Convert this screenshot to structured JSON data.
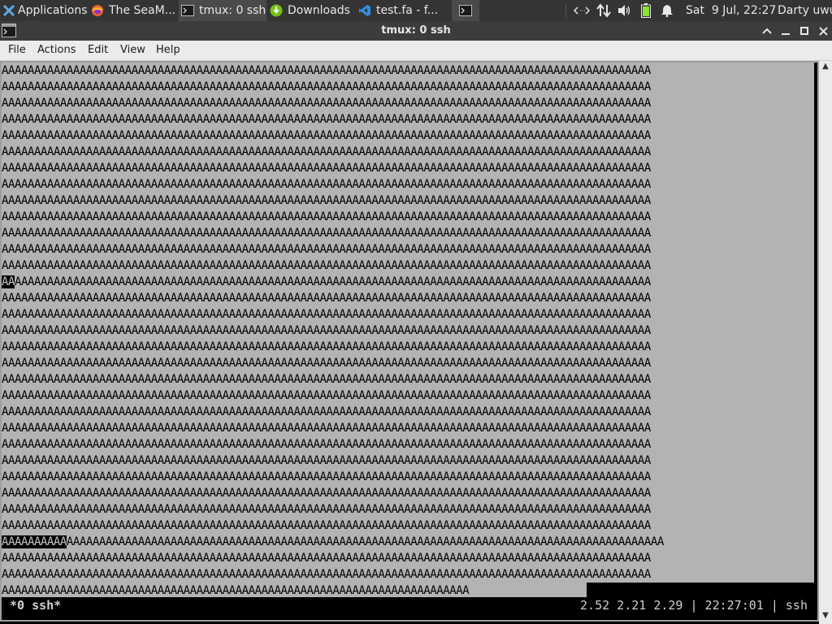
{
  "panel": {
    "applications_label": "Applications",
    "tasks": [
      {
        "label": "The SeaM...",
        "icon": "firefox-icon"
      },
      {
        "label": "tmux: 0 ssh",
        "icon": "terminal-icon"
      },
      {
        "label": "Downloads",
        "icon": "download-icon"
      },
      {
        "label": "test.fa - f...",
        "icon": "vscode-icon"
      }
    ],
    "datetime": "Sat  9 Jul, 22:27",
    "user": "Darty uwu"
  },
  "window": {
    "title": "tmux: 0 ssh"
  },
  "menubar": {
    "items": [
      "File",
      "Actions",
      "Edit",
      "View",
      "Help"
    ]
  },
  "terminal": {
    "full_line": "AAAAAAAAAAAAAAAAAAAAAAAAAAAAAAAAAAAAAAAAAAAAAAAAAAAAAAAAAAAAAAAAAAAAAAAAAAAAAAAAAAAAAAAAAAAAAAAAAAAA",
    "highlight_a": "AA",
    "rest_a": "AAAAAAAAAAAAAAAAAAAAAAAAAAAAAAAAAAAAAAAAAAAAAAAAAAAAAAAAAAAAAAAAAAAAAAAAAAAAAAAAAAAAAAAAAAAAAAAAAA",
    "highlight_b": "AAAAAAAAAA",
    "rest_b": "AAAAAAAAAAAAAAAAAAAAAAAAAAAAAAAAAAAAAAAAAAAAAAAAAAAAAAAAAAAAAAAAAAAAAAAAAAAAAAAAAAAAAAAAAAAA",
    "last_line": "AAAAAAAAAAAAAAAAAAAAAAAAAAAAAAAAAAAAAAAAAAAAAAAAAAAAAAAAAAAAAAAAAAAAAAAA"
  },
  "status": {
    "left": "*0 ssh*",
    "right": "2.52 2.21 2.29 | 22:27:01 | ssh"
  },
  "colors": {
    "panel_bg": "#343434",
    "terminal_bg": "#b3b3b3",
    "battery": "#8ae234",
    "downloads": "#73c216",
    "vscode": "#2f8fe0",
    "firefox": "#e6612b"
  }
}
